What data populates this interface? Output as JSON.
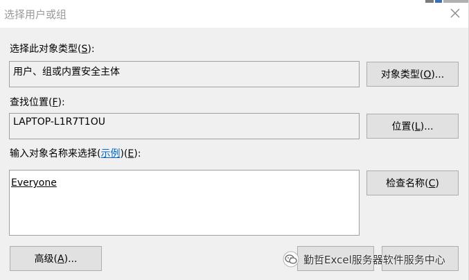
{
  "window": {
    "title": "选择用户或组"
  },
  "object_type": {
    "label_prefix": "选择此对象类型(",
    "label_key": "S",
    "label_suffix": "):",
    "value": "用户、组或内置安全主体",
    "button_prefix": "对象类型(",
    "button_key": "O",
    "button_suffix": ")..."
  },
  "location": {
    "label_prefix": "查找位置(",
    "label_key": "F",
    "label_suffix": "):",
    "value": "LAPTOP-L1R7T1OU",
    "button_prefix": "位置(",
    "button_key": "L",
    "button_suffix": ")..."
  },
  "names": {
    "label_prefix": "输入对象名称来选择(",
    "label_link": "示例",
    "label_mid": ")(",
    "label_key": "E",
    "label_suffix": "):",
    "value": "Everyone",
    "check_button_prefix": "检查名称(",
    "check_button_key": "C",
    "check_button_suffix": ")"
  },
  "advanced": {
    "button_prefix": "高级(",
    "button_key": "A",
    "button_suffix": ")..."
  },
  "watermark": {
    "text": "勤哲Excel服务器软件服务中心",
    "icon": "wechat-icon"
  },
  "colors": {
    "background": "#f0f0f0",
    "titlebar": "#ffffff",
    "link": "#0066cc",
    "border": "#a0a0a0",
    "button_bg": "#e1e1e1"
  }
}
